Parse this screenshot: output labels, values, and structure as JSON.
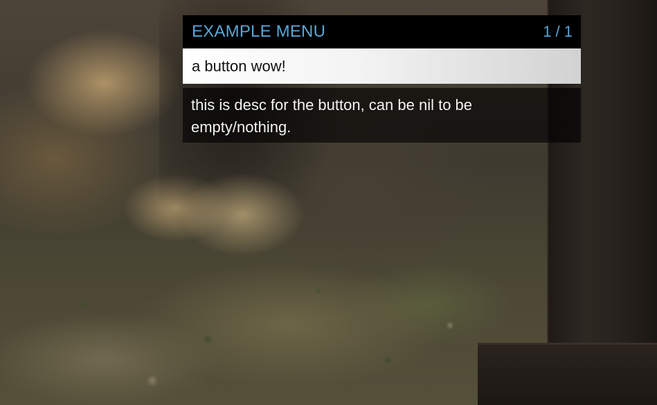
{
  "menu": {
    "title": "EXAMPLE MENU",
    "counter": "1 / 1",
    "items": [
      {
        "label": "a button wow!",
        "selected": true
      }
    ],
    "description": "this is desc for the button, can be nil to be empty/nothing."
  },
  "colors": {
    "header_background": "#000000",
    "title_text": "#5aa6d6",
    "selected_item_background": "#ffffff",
    "selected_item_text": "#111111",
    "description_background": "rgba(0,0,0,0.62)",
    "description_text": "#f2f2f2"
  }
}
